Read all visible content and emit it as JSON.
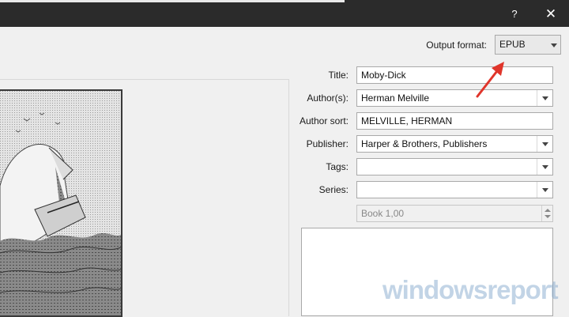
{
  "titlebar": {
    "help": "?",
    "close": "✕"
  },
  "output_format": {
    "label": "Output format:",
    "value": "EPUB"
  },
  "fields": {
    "title": {
      "label": "Title:",
      "value": "Moby-Dick"
    },
    "authors": {
      "label": "Author(s):",
      "value": "Herman Melville"
    },
    "author_sort": {
      "label": "Author sort:",
      "value": "MELVILLE, HERMAN"
    },
    "publisher": {
      "label": "Publisher:",
      "value": "Harper & Brothers, Publishers"
    },
    "tags": {
      "label": "Tags:",
      "value": ""
    },
    "series": {
      "label": "Series:",
      "value": ""
    },
    "series_index": {
      "value": "Book 1,00"
    }
  },
  "watermark": "windowsreport",
  "colors": {
    "annotation_arrow": "#e0352b",
    "titlebar": "#2b2b2b"
  },
  "icons": {
    "help": "help-icon",
    "close": "close-icon"
  }
}
